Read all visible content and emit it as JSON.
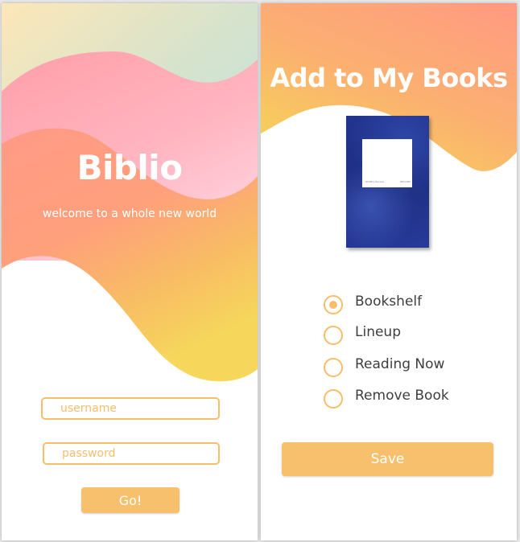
{
  "login": {
    "app_title": "Biblio",
    "subtitle": "welcome to a whole new world",
    "username_placeholder": "username",
    "password_placeholder": "password",
    "go_label": "Go!"
  },
  "add_to_books": {
    "title": "Add to My Books",
    "book_cover_label_left": "Wildfire Review",
    "book_cover_label_right": "RECORD",
    "options": [
      {
        "label": "Bookshelf",
        "selected": true
      },
      {
        "label": "Lineup",
        "selected": false
      },
      {
        "label": "Reading Now",
        "selected": false
      },
      {
        "label": "Remove Book",
        "selected": false
      }
    ],
    "save_label": "Save"
  },
  "colors": {
    "accent": "#f6be6b",
    "wave_pink": "#ffacb2",
    "wave_coral": "#ff9d7e",
    "wave_yellow": "#f6d35e",
    "wave_mint": "#c3e4dc",
    "book_blue": "#22348f"
  }
}
